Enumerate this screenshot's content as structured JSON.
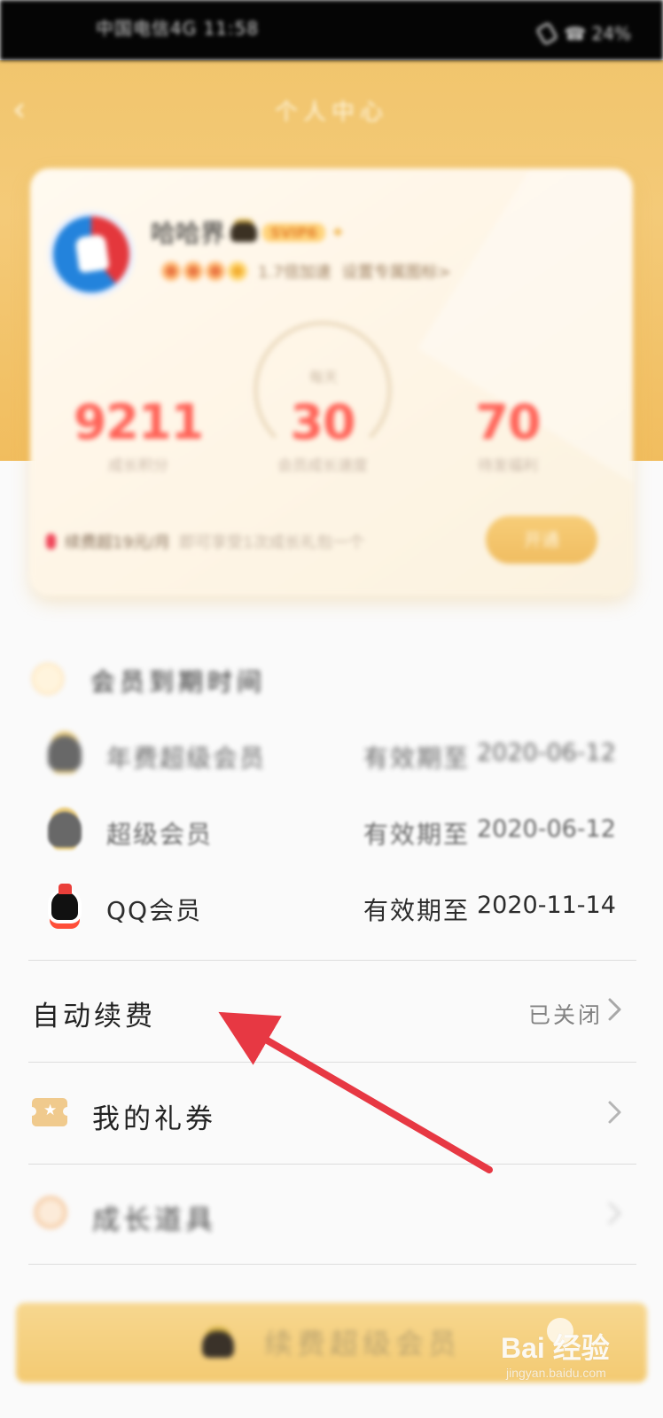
{
  "status_bar": {
    "left_text": "中国电信4G 11:58",
    "right_text": "☎ 24%"
  },
  "header": {
    "back_icon": "chevron-left-icon",
    "title": "个人中心"
  },
  "member_card": {
    "nickname": "哈哈界",
    "badge_text": "SVIP6",
    "level_text": "1.7倍加速",
    "level_note": "设置专属图标>",
    "stats": [
      {
        "value": "9211",
        "label": "成长积分"
      },
      {
        "value": "30",
        "label": "会员成长速度",
        "caption": "每天"
      },
      {
        "value": "70",
        "label": "待发福利"
      }
    ],
    "notice": "续费超19元/月",
    "notice_secondary": "即可享受1次成长礼包一个",
    "action_label": "开通"
  },
  "membership": {
    "section_title": "会员到期时间",
    "rows": [
      {
        "name": "年费超级会员",
        "expiry_label": "有效期至",
        "expiry_date": "2020-06-12"
      },
      {
        "name": "超级会员",
        "expiry_label": "有效期至",
        "expiry_date": "2020-06-12"
      },
      {
        "name": "QQ会员",
        "expiry_label": "有效期至",
        "expiry_date": "2020-11-14"
      }
    ]
  },
  "settings": {
    "auto_renew": {
      "label": "自动续费",
      "value": "已关闭"
    },
    "coupons": {
      "label": "我的礼券"
    },
    "growth": {
      "label": "成长道具"
    }
  },
  "bottom_button": {
    "label": "续费超级会员"
  },
  "watermark": {
    "text": "Bai 经验",
    "site": "jingyan.baidu.com"
  },
  "colors": {
    "header_gold": "#f1c56d",
    "annotation_red": "#e73843",
    "stat_red": "#ff6358",
    "button_gold": "#f3ca72"
  },
  "icons": {
    "back": "chevron-left-icon",
    "phone": "phone-icon",
    "coupon": "coupon-icon",
    "chevron": "chevron-right-icon"
  }
}
